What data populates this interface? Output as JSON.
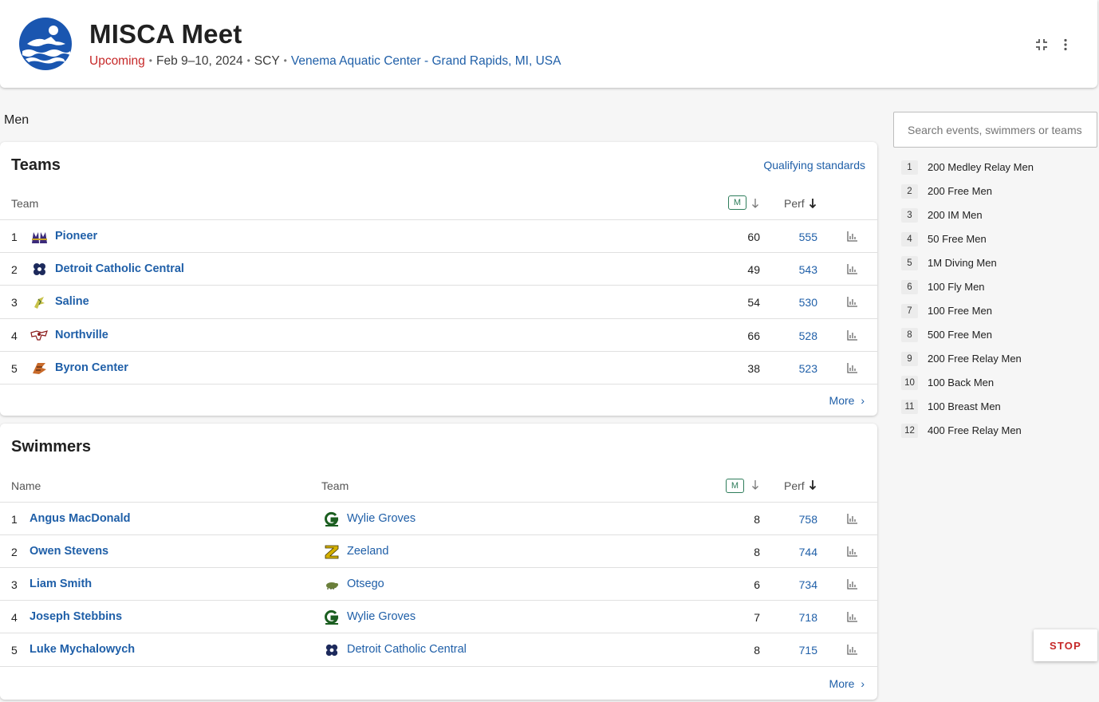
{
  "meet": {
    "title": "MISCA Meet",
    "status": "Upcoming",
    "dates": "Feb 9–10, 2024",
    "course": "SCY",
    "venue": "Venema Aquatic Center - Grand Rapids, MI, USA",
    "status_color": "#c62828"
  },
  "gender_label": "Men",
  "teams": {
    "title": "Teams",
    "qualifying_link": "Qualifying standards",
    "col_team": "Team",
    "col_m_badge": "M",
    "col_perf": "Perf",
    "more_label": "More",
    "rows": [
      {
        "rank": "1",
        "name": "Pioneer",
        "m": "60",
        "perf": "555",
        "icon": "pioneer-logo-icon"
      },
      {
        "rank": "2",
        "name": "Detroit Catholic Central",
        "m": "49",
        "perf": "543",
        "icon": "catholic-central-logo-icon"
      },
      {
        "rank": "3",
        "name": "Saline",
        "m": "54",
        "perf": "530",
        "icon": "saline-logo-icon"
      },
      {
        "rank": "4",
        "name": "Northville",
        "m": "66",
        "perf": "528",
        "icon": "northville-logo-icon"
      },
      {
        "rank": "5",
        "name": "Byron Center",
        "m": "38",
        "perf": "523",
        "icon": "byron-center-logo-icon"
      }
    ]
  },
  "swimmers": {
    "title": "Swimmers",
    "col_name": "Name",
    "col_team": "Team",
    "col_m_badge": "M",
    "col_perf": "Perf",
    "more_label": "More",
    "rows": [
      {
        "rank": "1",
        "name": "Angus MacDonald",
        "team": "Wylie Groves",
        "m": "8",
        "perf": "758"
      },
      {
        "rank": "2",
        "name": "Owen Stevens",
        "team": "Zeeland",
        "m": "8",
        "perf": "744"
      },
      {
        "rank": "3",
        "name": "Liam Smith",
        "team": "Otsego",
        "m": "6",
        "perf": "734"
      },
      {
        "rank": "4",
        "name": "Joseph Stebbins",
        "team": "Wylie Groves",
        "m": "7",
        "perf": "718"
      },
      {
        "rank": "5",
        "name": "Luke Mychalowych",
        "team": "Detroit Catholic Central",
        "m": "8",
        "perf": "715"
      }
    ]
  },
  "search": {
    "placeholder": "Search events, swimmers or teams"
  },
  "events": [
    {
      "num": "1",
      "name": "200 Medley Relay Men"
    },
    {
      "num": "2",
      "name": "200 Free Men"
    },
    {
      "num": "3",
      "name": "200 IM Men"
    },
    {
      "num": "4",
      "name": "50 Free Men"
    },
    {
      "num": "5",
      "name": "1M Diving Men"
    },
    {
      "num": "6",
      "name": "100 Fly Men"
    },
    {
      "num": "7",
      "name": "100 Free Men"
    },
    {
      "num": "8",
      "name": "500 Free Men"
    },
    {
      "num": "9",
      "name": "200 Free Relay Men"
    },
    {
      "num": "10",
      "name": "100 Back Men"
    },
    {
      "num": "11",
      "name": "100 Breast Men"
    },
    {
      "num": "12",
      "name": "400 Free Relay Men"
    }
  ],
  "stop_label": "STOP",
  "colors": {
    "link": "#1f5fa8",
    "accent_green": "#2e7d5b",
    "stop_red": "#c62828"
  }
}
